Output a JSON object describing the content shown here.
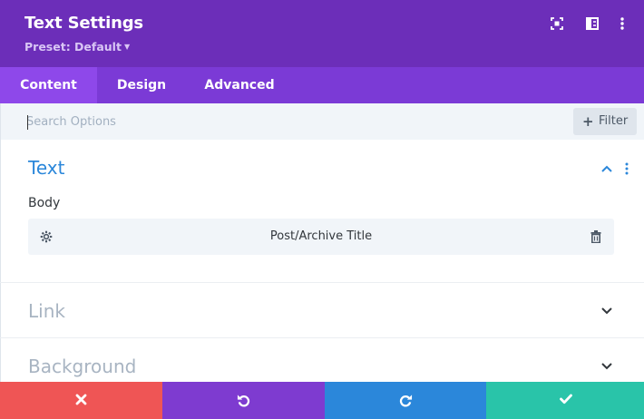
{
  "header": {
    "title": "Text Settings",
    "preset": "Preset: Default",
    "icons": [
      "focus-mode-icon",
      "split-view-icon",
      "more-options-icon"
    ]
  },
  "tabs": [
    {
      "label": "Content",
      "active": true
    },
    {
      "label": "Design",
      "active": false
    },
    {
      "label": "Advanced",
      "active": false
    }
  ],
  "search": {
    "placeholder": "Search Options",
    "filter_label": "Filter"
  },
  "sections": {
    "text": {
      "title": "Text",
      "expanded": true,
      "body_label": "Body",
      "body_value": "Post/Archive Title"
    },
    "link": {
      "title": "Link",
      "expanded": false
    },
    "background": {
      "title": "Background",
      "expanded": false
    }
  },
  "footer": {
    "buttons": [
      "discard-changes",
      "undo",
      "redo",
      "save-changes"
    ]
  },
  "colors": {
    "header": "#6c2eb9",
    "tabs": "#7b3ad6",
    "active_tab": "#8e48ea",
    "accent_blue": "#2b87da",
    "discard": "#ef5555",
    "undo": "#7e3bd0",
    "redo": "#2b87da",
    "save": "#29c4a9"
  }
}
